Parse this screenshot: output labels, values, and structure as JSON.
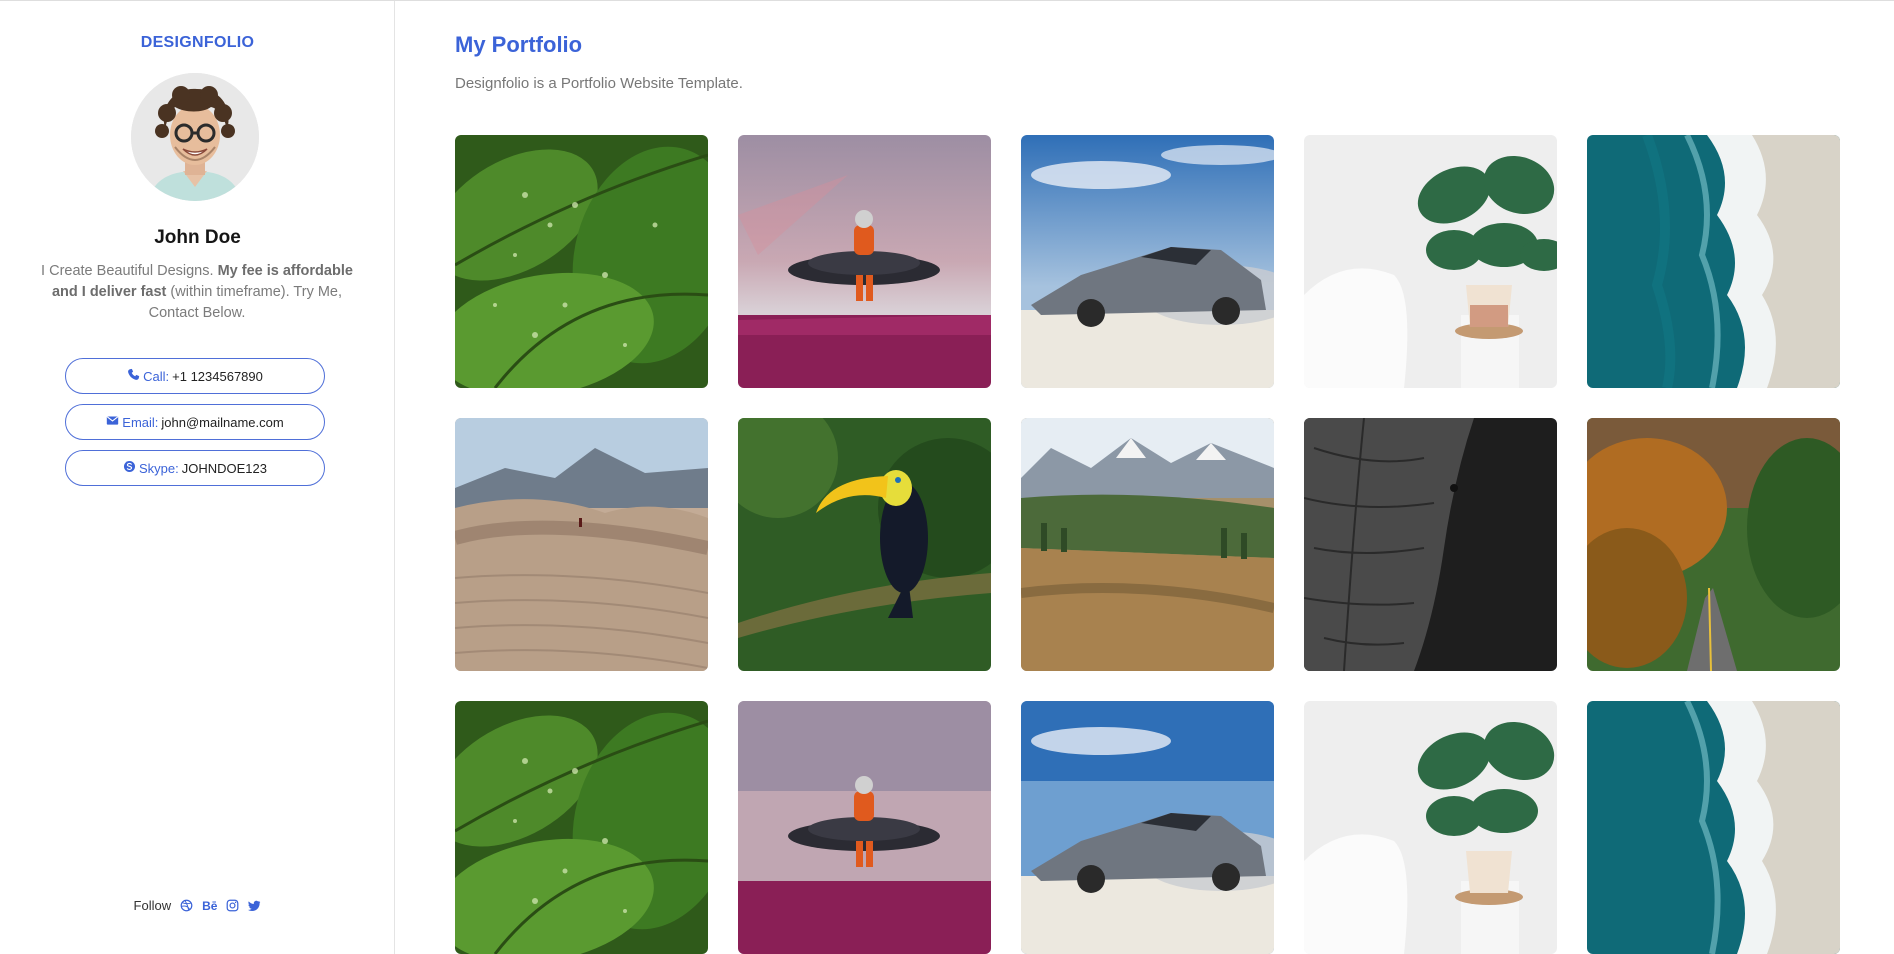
{
  "sidebar": {
    "brand": "DESIGNFOLIO",
    "name": "John Doe",
    "bio": {
      "text1": "I Create Beautiful Designs. ",
      "bold": "My fee is affordable and I deliver fast",
      "text2": " (within timeframe). Try Me, Contact Below."
    },
    "contacts": [
      {
        "icon": "phone-icon",
        "label": "Call:",
        "value": "+1 1234567890"
      },
      {
        "icon": "envelope-icon",
        "label": "Email:",
        "value": "john@mailname.com"
      },
      {
        "icon": "skype-icon",
        "label": "Skype:",
        "value": "JOHNDOE123"
      }
    ],
    "follow": {
      "label": "Follow",
      "behance_text": "Bē",
      "icons": [
        "dribbble-icon",
        "behance-icon",
        "instagram-icon",
        "twitter-icon"
      ]
    }
  },
  "main": {
    "title": "My Portfolio",
    "subtitle": "Designfolio is a Portfolio Website Template."
  },
  "colors": {
    "accent": "#3b63d8",
    "text": "#222222",
    "muted": "#7b7b7b",
    "border": "#e4e4e4"
  },
  "gallery": [
    "leaves-photo",
    "astronaut-photo",
    "sports-car-photo",
    "monstera-plant-photo",
    "ocean-shore-photo",
    "desert-dunes-photo",
    "toucan-photo",
    "mountain-valley-photo",
    "elephant-photo",
    "autumn-road-photo",
    "leaves-photo",
    "astronaut-photo",
    "sports-car-photo",
    "monstera-plant-photo",
    "ocean-shore-photo"
  ]
}
